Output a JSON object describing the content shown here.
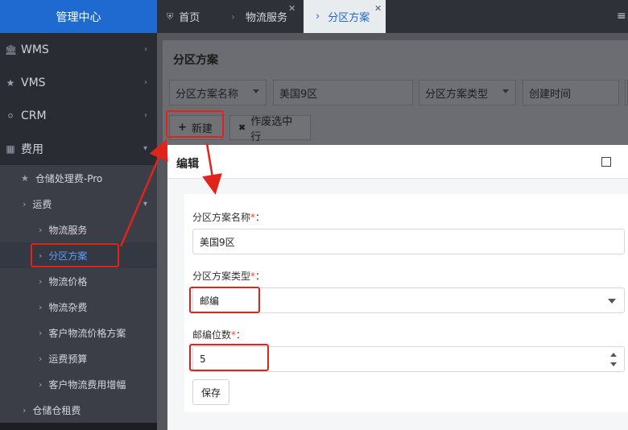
{
  "sidebar": {
    "brand": "管理中心",
    "menu": [
      {
        "label": "WMS",
        "icon": "bank-icon"
      },
      {
        "label": "VMS",
        "icon": "star-icon"
      },
      {
        "label": "CRM",
        "icon": "user-circle-icon"
      },
      {
        "label": "费用",
        "icon": "table-icon"
      }
    ],
    "sub": [
      {
        "label": "仓储处理费-Pro"
      },
      {
        "label": "运费"
      },
      {
        "label": "物流服务"
      },
      {
        "label": "分区方案"
      },
      {
        "label": "物流价格"
      },
      {
        "label": "物流杂费"
      },
      {
        "label": "客户物流价格方案"
      },
      {
        "label": "运费预算"
      },
      {
        "label": "客户物流费用增幅"
      },
      {
        "label": "仓储仓租费"
      }
    ]
  },
  "tabs": [
    {
      "label": "首页"
    },
    {
      "label": "物流服务"
    },
    {
      "label": "分区方案"
    }
  ],
  "page": {
    "title": "分区方案",
    "filters": {
      "scheme_name_select": "分区方案名称",
      "scheme_name_value": "美国9区",
      "scheme_type_select": "分区方案类型",
      "created_time_select": "创建时间"
    },
    "toolbar": {
      "new_label": "新建",
      "void_label": "作废选中行"
    }
  },
  "modal": {
    "title": "编辑",
    "fields": {
      "name_label": "分区方案名称",
      "name_value": "美国9区",
      "type_label": "分区方案类型",
      "type_value": "邮编",
      "digits_label": "邮编位数",
      "digits_value": "5"
    },
    "required_mark": "*",
    "colon": "：",
    "save_label": "保存"
  },
  "colors": {
    "accent": "#1f6ad0",
    "annotation": "#e0241b"
  }
}
